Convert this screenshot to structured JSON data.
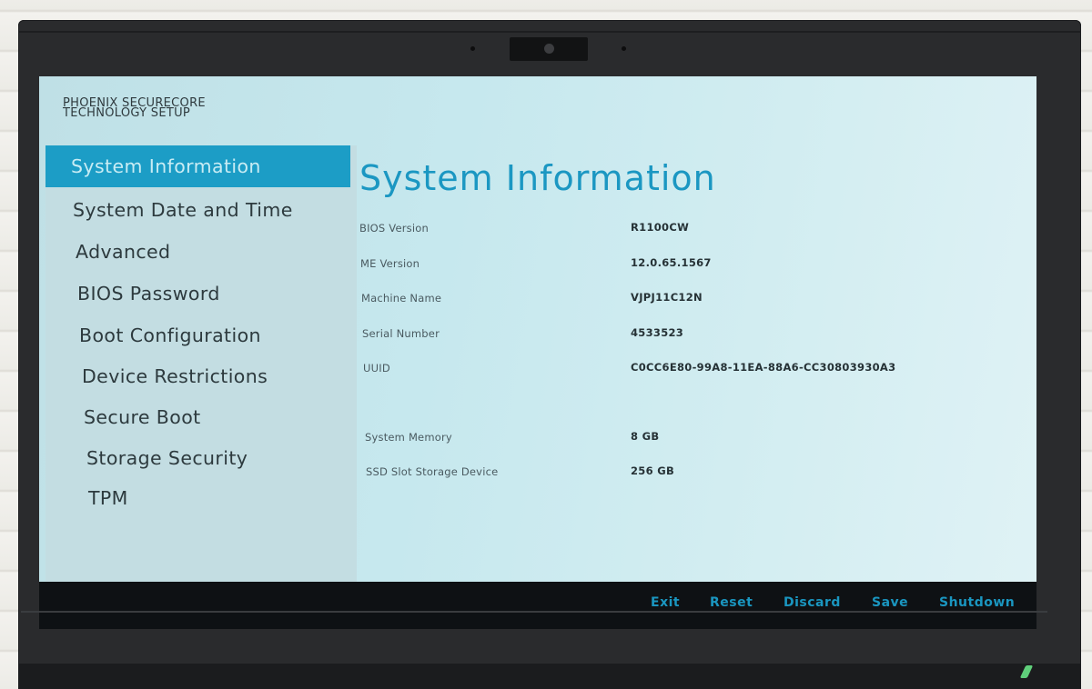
{
  "header": {
    "brand_line1": "PHOENIX SECURECORE",
    "brand_line2": "TECHNOLOGY SETUP"
  },
  "sidebar": {
    "items": [
      {
        "label": "System Information",
        "selected": true
      },
      {
        "label": "System Date and Time",
        "selected": false
      },
      {
        "label": "Advanced",
        "selected": false
      },
      {
        "label": "BIOS Password",
        "selected": false
      },
      {
        "label": "Boot Configuration",
        "selected": false
      },
      {
        "label": "Device Restrictions",
        "selected": false
      },
      {
        "label": "Secure Boot",
        "selected": false
      },
      {
        "label": "Storage Security",
        "selected": false
      },
      {
        "label": "TPM",
        "selected": false
      }
    ]
  },
  "main": {
    "title": "System Information",
    "fields": [
      {
        "label": "BIOS Version",
        "value": "R1100CW"
      },
      {
        "label": "ME Version",
        "value": "12.0.65.1567"
      },
      {
        "label": "Machine Name",
        "value": "VJPJ11C12N"
      },
      {
        "label": "Serial Number",
        "value": "4533523"
      },
      {
        "label": "UUID",
        "value": "C0CC6E80-99A8-11EA-88A6-CC30803930A3"
      },
      {
        "label": "System Memory",
        "value": "8 GB"
      },
      {
        "label": "SSD Slot Storage Device",
        "value": "256 GB"
      }
    ]
  },
  "footer": {
    "buttons": [
      {
        "label": "Exit"
      },
      {
        "label": "Reset"
      },
      {
        "label": "Discard"
      },
      {
        "label": "Save"
      },
      {
        "label": "Shutdown"
      }
    ]
  },
  "colors": {
    "accent": "#1c9dc6",
    "selected_text": "#c8ecf4",
    "content_bg": "#c6e8ee",
    "footer_bg": "#0e1114"
  }
}
